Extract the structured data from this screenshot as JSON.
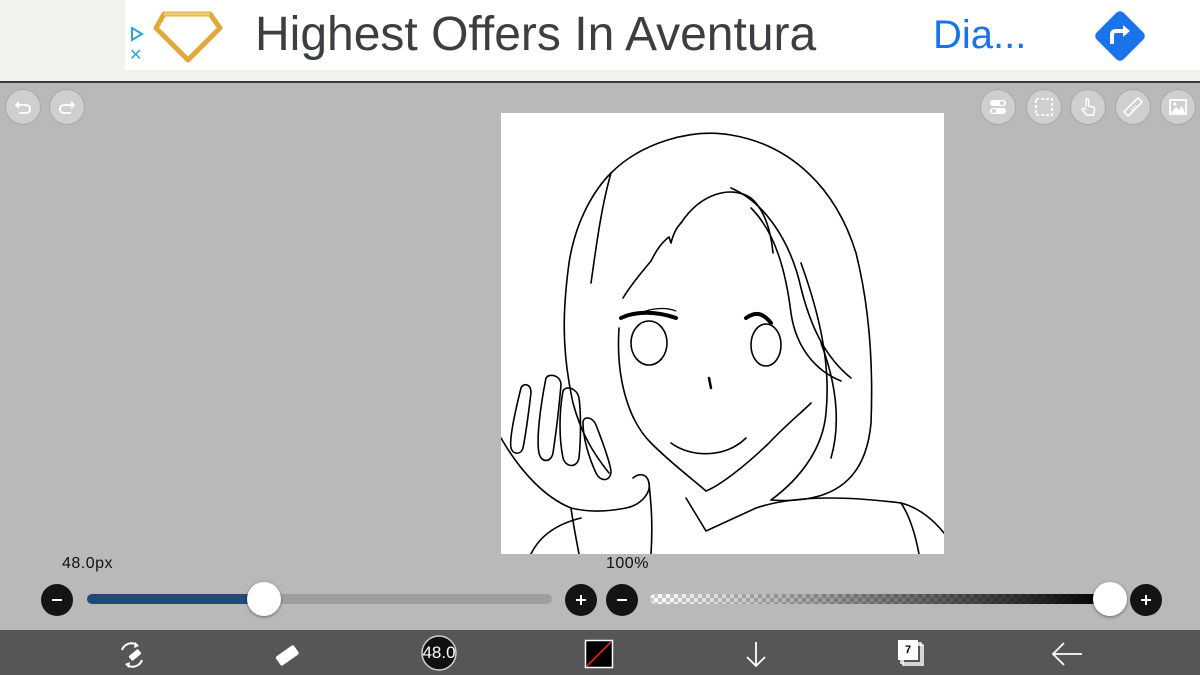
{
  "ad": {
    "headline": "Highest Offers In Aventura",
    "cta": "Dia...",
    "icons": {
      "adchoices": "adchoices-icon",
      "close": "close-icon",
      "logo": "diamond-logo-icon",
      "directions": "directions-icon"
    },
    "colors": {
      "headline": "#3c3f42",
      "cta": "#1a73e8",
      "directions": "#1a73e8",
      "logo": "#e0a93a"
    }
  },
  "toolbar_left": [
    {
      "name": "undo",
      "icon": "undo-icon"
    },
    {
      "name": "redo",
      "icon": "redo-icon"
    }
  ],
  "toolbar_right": [
    {
      "name": "settings",
      "icon": "toggle-settings-icon"
    },
    {
      "name": "selection",
      "icon": "selection-icon"
    },
    {
      "name": "hand",
      "icon": "hand-pointer-icon"
    },
    {
      "name": "ruler",
      "icon": "ruler-icon"
    },
    {
      "name": "material",
      "icon": "image-icon"
    }
  ],
  "brush_size_slider": {
    "label": "48.0px",
    "value_fraction": 0.38,
    "color": "#1f4a7a"
  },
  "opacity_slider": {
    "label": "100%",
    "value_percent": 100
  },
  "bottom_bar": {
    "tool_transform_icon": "transform-icon",
    "eraser_icon": "eraser-icon",
    "brush_size": "48.0",
    "color_icon": "color-swatch-icon",
    "move_down_icon": "arrow-down-icon",
    "layers_count": "7",
    "back_icon": "arrow-left-icon"
  }
}
